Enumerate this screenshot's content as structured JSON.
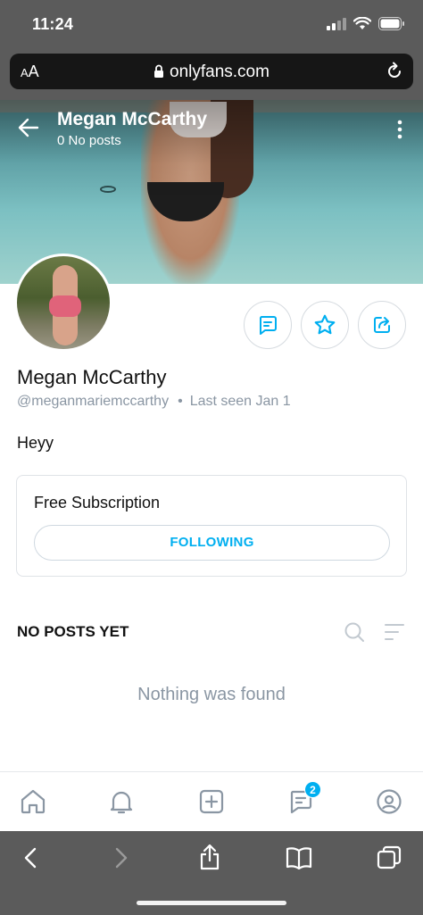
{
  "status_bar": {
    "time": "11:24"
  },
  "browser": {
    "aa_small": "A",
    "aa_large": "A",
    "url": "onlyfans.com"
  },
  "cover": {
    "name": "Megan McCarthy",
    "posts_count": "0",
    "posts_label": "No posts"
  },
  "profile": {
    "name": "Megan McCarthy",
    "handle": "@meganmariemccarthy",
    "dot": "•",
    "last_seen": "Last seen Jan 1",
    "bio": "Heyy"
  },
  "subscription": {
    "title": "Free Subscription",
    "button_label": "FOLLOWING"
  },
  "posts": {
    "heading": "NO POSTS YET",
    "empty_message": "Nothing was found"
  },
  "bottom_nav": {
    "messages_badge": "2"
  },
  "colors": {
    "accent": "#00aff0",
    "muted": "#8a96a3",
    "browser_chrome": "#5b5b5b"
  },
  "icons": [
    "back-arrow-icon",
    "more-vertical-icon",
    "message-icon",
    "star-icon",
    "share-icon",
    "search-icon",
    "sort-icon",
    "home-icon",
    "bell-icon",
    "add-post-icon",
    "chat-icon",
    "profile-icon"
  ]
}
